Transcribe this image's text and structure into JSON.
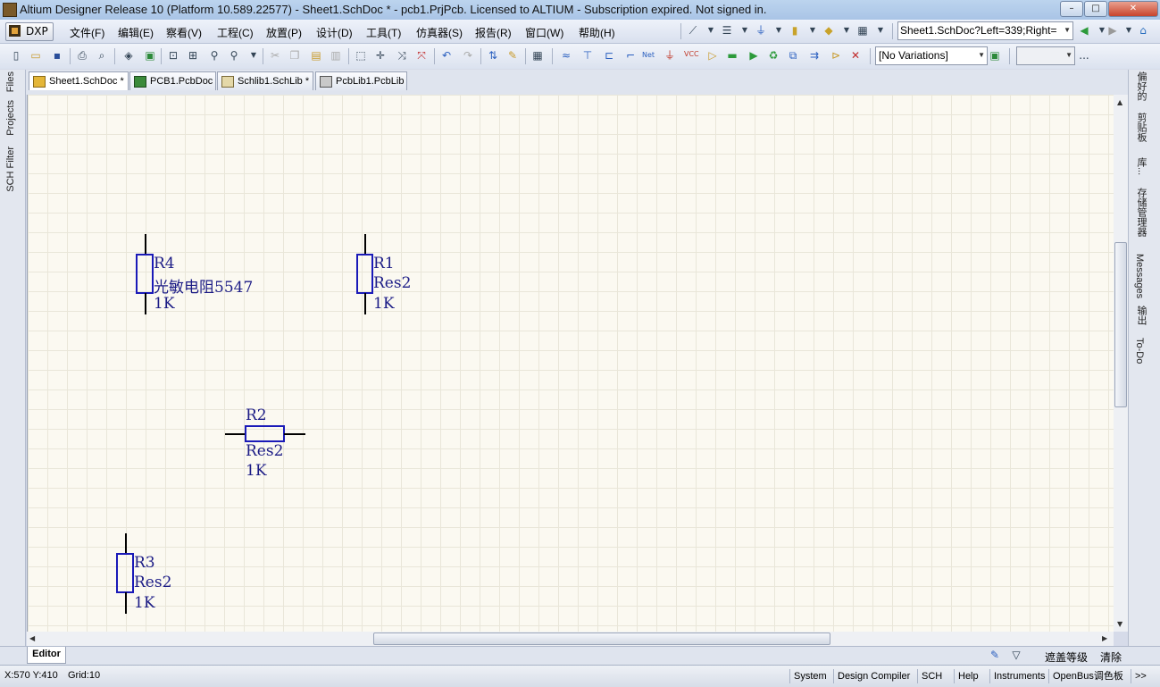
{
  "window": {
    "title": "Altium Designer Release 10 (Platform 10.589.22577) - Sheet1.SchDoc * - pcb1.PrjPcb. Licensed to ALTIUM - Subscription expired. Not signed in.",
    "minimize": "–",
    "maximize": "□",
    "close": "✕"
  },
  "menu": {
    "dxp": "DXP",
    "items": [
      "文件(F)",
      "编辑(E)",
      "察看(V)",
      "工程(C)",
      "放置(P)",
      "设计(D)",
      "工具(T)",
      "仿真器(S)",
      "报告(R)",
      "窗口(W)",
      "帮助(H)"
    ]
  },
  "toolbar": {
    "location_combo": "Sheet1.SchDoc?Left=339;Right=",
    "variations_combo": "[No Variations]",
    "extra_combo": "",
    "overflow": "..."
  },
  "doc_tabs": [
    {
      "label": "Sheet1.SchDoc *",
      "icon": "schdoc-icon"
    },
    {
      "label": "PCB1.PcbDoc",
      "icon": "pcbdoc-icon"
    },
    {
      "label": "Schlib1.SchLib *",
      "icon": "schlib-icon"
    },
    {
      "label": "PcbLib1.PcbLib",
      "icon": "pcblib-icon"
    }
  ],
  "left_panels": [
    "Files",
    "Projects",
    "SCH Filter"
  ],
  "right_panels": [
    "偏好的",
    "剪贴板",
    "库...",
    "存储管理器",
    "Messages",
    "输出",
    "To-Do"
  ],
  "schematic": {
    "components": [
      {
        "designator": "R4",
        "comment": "光敏电阻5547",
        "value": "1K"
      },
      {
        "designator": "R1",
        "comment": "Res2",
        "value": "1K"
      },
      {
        "designator": "R2",
        "comment": "Res2",
        "value": "1K"
      },
      {
        "designator": "R3",
        "comment": "Res2",
        "value": "1K"
      }
    ],
    "wire_color": "#000000",
    "body_color": "#1a1ab8",
    "text_color": "#1c1c86"
  },
  "editor_tab": "Editor",
  "bottom_right": {
    "mask_level": "遮盖等级",
    "clear": "清除"
  },
  "status": {
    "coords": "X:570 Y:410",
    "grid": "Grid:10",
    "buttons": [
      "System",
      "Design Compiler",
      "SCH",
      "Help",
      "Instruments",
      "OpenBus调色板",
      ">>"
    ]
  }
}
